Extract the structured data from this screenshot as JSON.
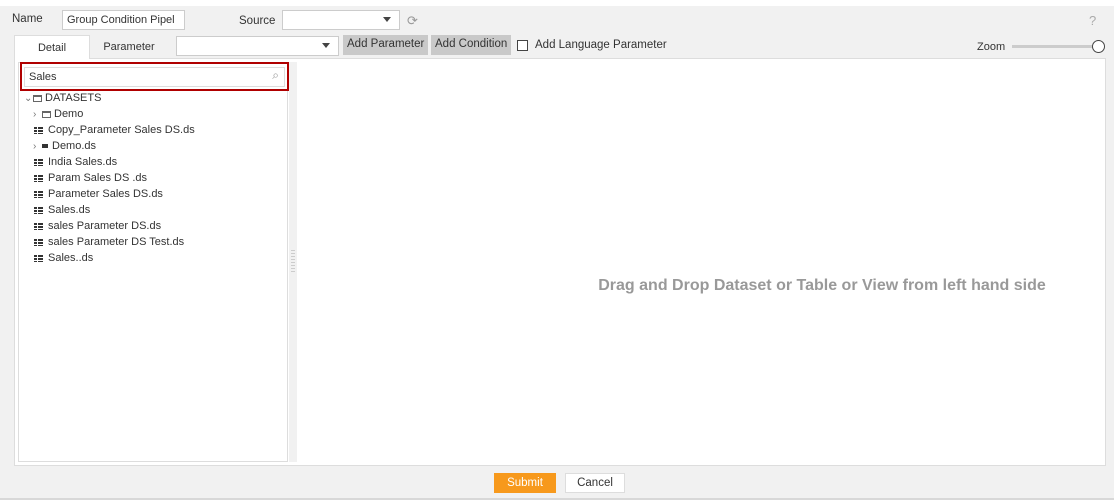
{
  "header": {
    "name_label": "Name",
    "name_value": "Group Condition Pipel",
    "source_label": "Source",
    "source_value": "",
    "help": "?"
  },
  "tabs": [
    {
      "label": "Detail",
      "active": true
    },
    {
      "label": "Parameter",
      "active": false
    }
  ],
  "toolbar": {
    "parameter_select_value": "",
    "add_parameter": "Add Parameter",
    "add_condition": "Add Condition",
    "language_param_label": "Add Language Parameter",
    "language_param_checked": false,
    "zoom_label": "Zoom",
    "zoom_level": 1.0
  },
  "search": {
    "value": "Sales"
  },
  "tree": {
    "root": "DATASETS",
    "items": [
      {
        "label": "Demo",
        "type": "folder",
        "expandable": true
      },
      {
        "label": "Copy_Parameter Sales DS.ds",
        "type": "dataset",
        "expandable": false
      },
      {
        "label": "Demo.ds",
        "type": "dataset-small",
        "expandable": true
      },
      {
        "label": "India Sales.ds",
        "type": "dataset",
        "expandable": false
      },
      {
        "label": "Param Sales DS .ds",
        "type": "dataset",
        "expandable": false
      },
      {
        "label": "Parameter Sales DS.ds",
        "type": "dataset",
        "expandable": false
      },
      {
        "label": "Sales.ds",
        "type": "dataset",
        "expandable": false
      },
      {
        "label": "sales Parameter DS.ds",
        "type": "dataset",
        "expandable": false
      },
      {
        "label": "sales Parameter DS Test.ds",
        "type": "dataset",
        "expandable": false
      },
      {
        "label": "Sales..ds",
        "type": "dataset",
        "expandable": false
      }
    ]
  },
  "canvas": {
    "hint": "Drag and Drop Dataset or Table or View from left hand side"
  },
  "footer": {
    "submit": "Submit",
    "cancel": "Cancel"
  },
  "colors": {
    "submit": "#f7991c",
    "search_highlight": "#b00000"
  }
}
